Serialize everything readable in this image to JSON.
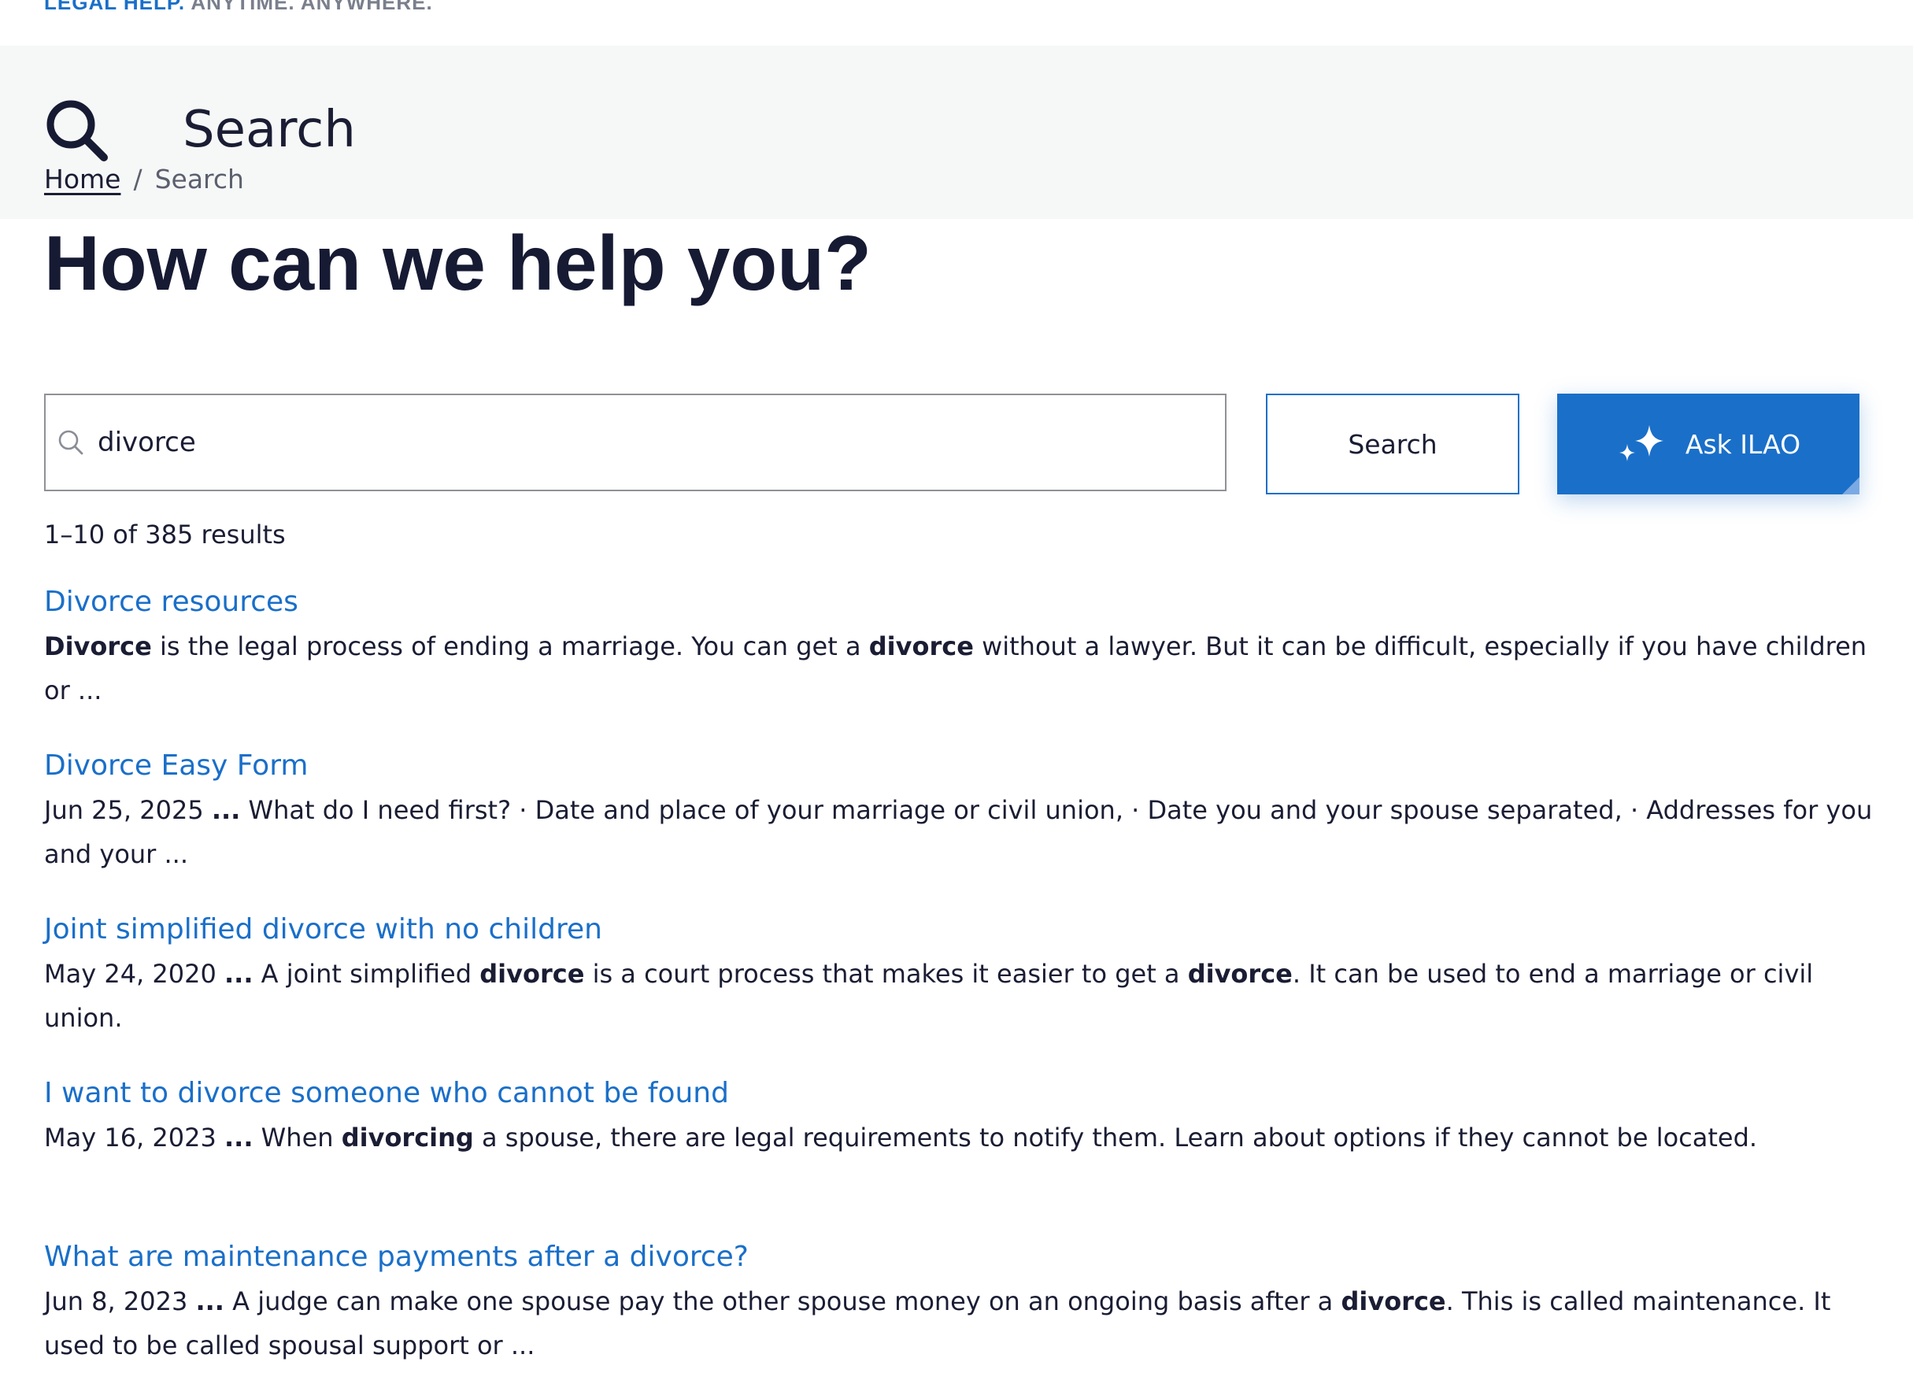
{
  "site": {
    "tagline_part1": "LEGAL HELP.",
    "tagline_part2": " ANYTIME. ANYWHERE."
  },
  "header": {
    "title": "Search",
    "icon": "search-icon"
  },
  "breadcrumb": {
    "home": "Home",
    "separator": "/",
    "current": "Search"
  },
  "main": {
    "heading": "How can we help you?"
  },
  "search": {
    "value": "divorce",
    "button_label": "Search",
    "ask_label": "Ask ILAO",
    "ask_icon": "sparkle-icon"
  },
  "results_summary": "1–10 of 385 results",
  "results": [
    {
      "title": "Divorce resources",
      "snippet": [
        {
          "text": "Divorce",
          "bold": true
        },
        {
          "text": " is the legal process of ending a marriage. You can get a ",
          "bold": false
        },
        {
          "text": "divorce",
          "bold": true
        },
        {
          "text": " without a lawyer. But it can be difficult, especially if you have children or ...",
          "bold": false
        }
      ]
    },
    {
      "title": "Divorce Easy Form",
      "snippet": [
        {
          "text": "Jun 25, 2025 ",
          "bold": false
        },
        {
          "text": "...",
          "bold": true
        },
        {
          "text": " What do I need first? · Date and place of your marriage or civil union, · Date you and your spouse separated, · Addresses for you and your ...",
          "bold": false
        }
      ]
    },
    {
      "title": "Joint simplified divorce with no children",
      "snippet": [
        {
          "text": "May 24, 2020 ",
          "bold": false
        },
        {
          "text": "...",
          "bold": true
        },
        {
          "text": " A joint simplified ",
          "bold": false
        },
        {
          "text": "divorce",
          "bold": true
        },
        {
          "text": " is a court process that makes it easier to get a ",
          "bold": false
        },
        {
          "text": "divorce",
          "bold": true
        },
        {
          "text": ". It can be used to end a marriage or civil union.",
          "bold": false
        }
      ]
    },
    {
      "title": "I want to divorce someone who cannot be found",
      "snippet": [
        {
          "text": "May 16, 2023 ",
          "bold": false
        },
        {
          "text": "...",
          "bold": true
        },
        {
          "text": " When ",
          "bold": false
        },
        {
          "text": "divorcing",
          "bold": true
        },
        {
          "text": " a spouse, there are legal requirements to notify them. Learn about options if they cannot be located.",
          "bold": false
        }
      ]
    },
    {
      "title": "What are maintenance payments after a divorce?",
      "snippet": [
        {
          "text": "Jun 8, 2023 ",
          "bold": false
        },
        {
          "text": "...",
          "bold": true
        },
        {
          "text": " A judge can make one spouse pay the other spouse money on an ongoing basis after a ",
          "bold": false
        },
        {
          "text": "divorce",
          "bold": true
        },
        {
          "text": ". This is called maintenance. It used to be called spousal support or ...",
          "bold": false
        }
      ]
    }
  ],
  "colors": {
    "link": "#1a6fc9",
    "text": "#1a1d33",
    "header_bg": "#f6f7f7",
    "ask_bg": "#1a6fc9"
  }
}
